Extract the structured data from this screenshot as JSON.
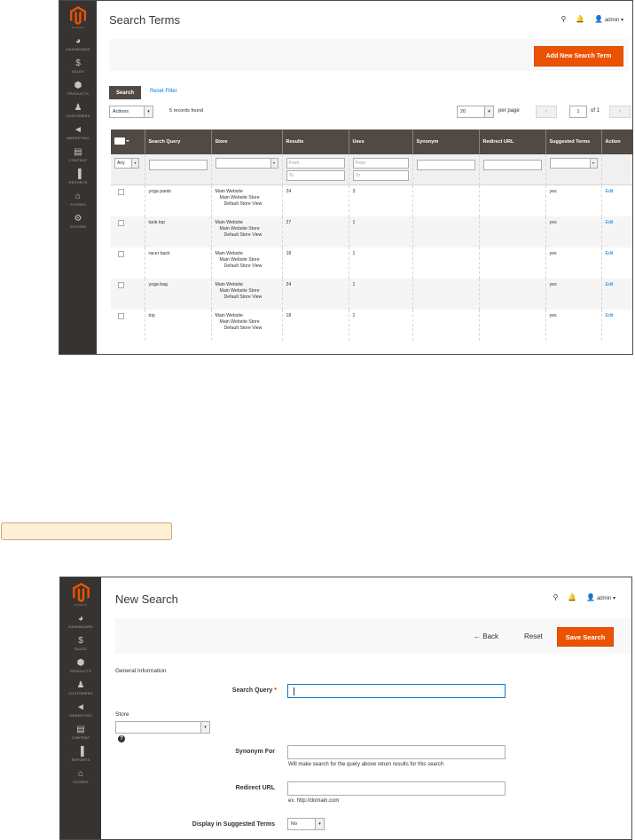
{
  "screen1": {
    "nav": [
      {
        "label": "DASHBOARD",
        "icon": "dashboard-icon"
      },
      {
        "label": "SALES",
        "icon": "dollar-icon"
      },
      {
        "label": "PRODUCTS",
        "icon": "cube-icon"
      },
      {
        "label": "CUSTOMERS",
        "icon": "person-icon"
      },
      {
        "label": "MARKETING",
        "icon": "megaphone-icon"
      },
      {
        "label": "CONTENT",
        "icon": "layout-icon"
      },
      {
        "label": "REPORTS",
        "icon": "bar-chart-icon"
      },
      {
        "label": "STORES",
        "icon": "store-icon"
      },
      {
        "label": "SYSTEM",
        "icon": "gear-icon"
      }
    ],
    "title": "Search Terms",
    "user": "admin",
    "add_button": "Add New Search Term",
    "search_button": "Search",
    "reset_filter": "Reset Filter",
    "actions_label": "Actions",
    "records_found": "5 records found",
    "per_page_value": "20",
    "per_page_label": "per page",
    "page_current": "1",
    "page_of": "of 1",
    "columns": [
      "Search Query",
      "Store",
      "Results",
      "Uses",
      "Synonym",
      "Redirect URL",
      "Suggested Terms",
      "Action"
    ],
    "filter": {
      "any": "Any",
      "from": "From",
      "to": "To"
    },
    "rows": [
      {
        "query": "yoga pants",
        "store": [
          "Main Website",
          "Main Website Store",
          "Default Store View"
        ],
        "results": "24",
        "uses": "3",
        "synonym": "",
        "redirect": "",
        "suggested": "yes",
        "action": "Edit"
      },
      {
        "query": "tank top",
        "store": [
          "Main Website",
          "Main Website Store",
          "Default Store View"
        ],
        "results": "27",
        "uses": "1",
        "synonym": "",
        "redirect": "",
        "suggested": "yes",
        "action": "Edit"
      },
      {
        "query": "racer back",
        "store": [
          "Main Website",
          "Main Website Store",
          "Default Store View"
        ],
        "results": "18",
        "uses": "1",
        "synonym": "",
        "redirect": "",
        "suggested": "yes",
        "action": "Edit"
      },
      {
        "query": "yoga bag",
        "store": [
          "Main Website",
          "Main Website Store",
          "Default Store View"
        ],
        "results": "24",
        "uses": "1",
        "synonym": "",
        "redirect": "",
        "suggested": "yes",
        "action": "Edit"
      },
      {
        "query": "top",
        "store": [
          "Main Website",
          "Main Website Store",
          "Default Store View"
        ],
        "results": "18",
        "uses": "1",
        "synonym": "",
        "redirect": "",
        "suggested": "yes",
        "action": "Edit"
      }
    ]
  },
  "screen2": {
    "nav": [
      {
        "label": "DASHBOARD",
        "icon": "dashboard-icon"
      },
      {
        "label": "SALES",
        "icon": "dollar-icon"
      },
      {
        "label": "PRODUCTS",
        "icon": "cube-icon"
      },
      {
        "label": "CUSTOMERS",
        "icon": "person-icon"
      },
      {
        "label": "MARKETING",
        "icon": "megaphone-icon"
      },
      {
        "label": "CONTENT",
        "icon": "layout-icon"
      },
      {
        "label": "REPORTS",
        "icon": "bar-chart-icon"
      },
      {
        "label": "STORES",
        "icon": "store-icon"
      }
    ],
    "title": "New Search",
    "user": "admin",
    "back_button": "Back",
    "reset_button": "Reset",
    "save_button": "Save Search",
    "section_title": "General Information",
    "search_query_label": "Search Query",
    "store_label": "Store",
    "synonym_label": "Synonym For",
    "synonym_note": "Will make search for the query above return results for this search",
    "redirect_label": "Redirect URL",
    "redirect_note": "ex. http://domain.com",
    "suggested_label": "Display in Suggested Terms",
    "suggested_value": "No"
  },
  "colors": {
    "accent": "#eb5202",
    "sidebar": "#373330",
    "header": "#514943",
    "link": "#007bdb"
  }
}
